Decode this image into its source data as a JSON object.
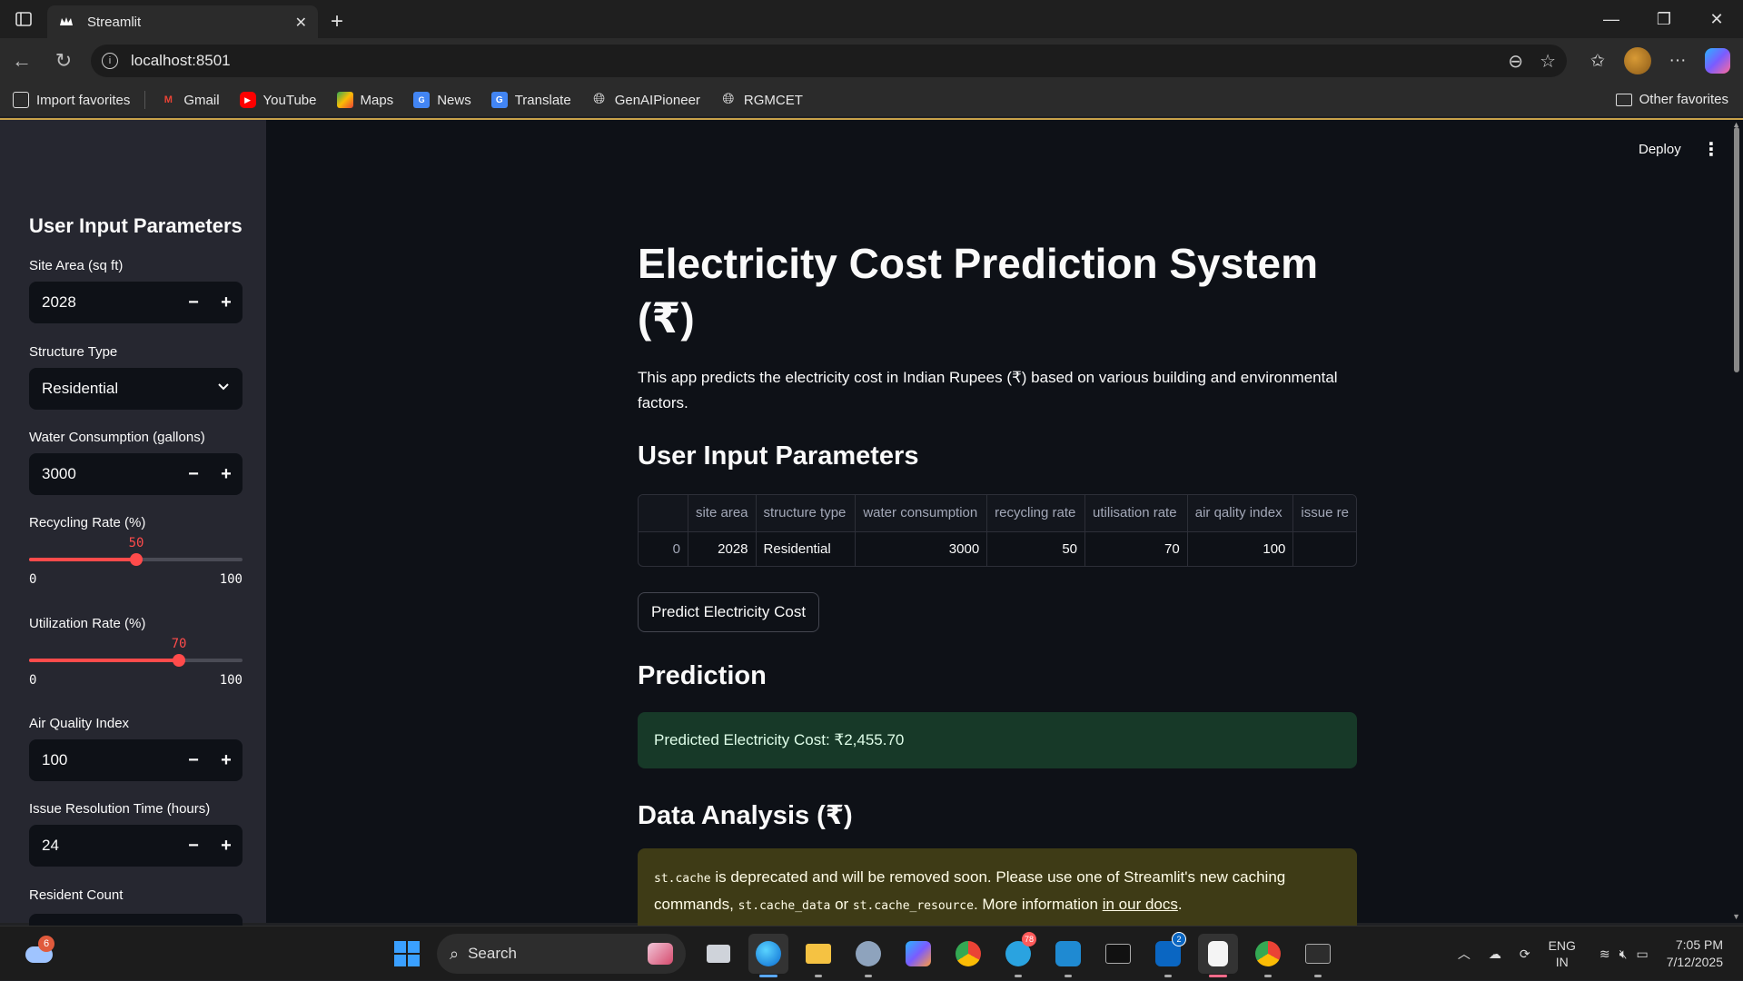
{
  "browser": {
    "tab_title": "Streamlit",
    "url": "localhost:8501",
    "favorites": [
      {
        "label": "Import favorites",
        "icon": "import-icon"
      },
      {
        "label": "Gmail",
        "icon": "gmail-icon",
        "color": "#ea4335"
      },
      {
        "label": "YouTube",
        "icon": "youtube-icon",
        "color": "#ff0000"
      },
      {
        "label": "Maps",
        "icon": "maps-icon",
        "color": "#34a853"
      },
      {
        "label": "News",
        "icon": "news-icon",
        "color": "#4285f4"
      },
      {
        "label": "Translate",
        "icon": "translate-icon",
        "color": "#4285f4"
      },
      {
        "label": "GenAIPioneer",
        "icon": "globe-icon"
      },
      {
        "label": "RGMCET",
        "icon": "globe-icon"
      }
    ],
    "other_favorites": "Other favorites"
  },
  "app": {
    "deploy": "Deploy",
    "accent": "#ff4b4b"
  },
  "sidebar": {
    "title": "User Input Parameters",
    "site_area": {
      "label": "Site Area (sq ft)",
      "value": "2028"
    },
    "structure_type": {
      "label": "Structure Type",
      "value": "Residential"
    },
    "water": {
      "label": "Water Consumption (gallons)",
      "value": "3000"
    },
    "recycling": {
      "label": "Recycling Rate (%)",
      "value": 50,
      "min": "0",
      "max": "100"
    },
    "utilization": {
      "label": "Utilization Rate (%)",
      "value": 70,
      "min": "0",
      "max": "100"
    },
    "aqi": {
      "label": "Air Quality Index",
      "value": "100"
    },
    "issue_time": {
      "label": "Issue Resolution Time (hours)",
      "value": "24"
    },
    "resident_count": {
      "label": "Resident Count"
    }
  },
  "main": {
    "title": "Electricity Cost Prediction System (₹)",
    "description": "This app predicts the electricity cost in Indian Rupees (₹) based on various building and environmental factors.",
    "params_heading": "User Input Parameters",
    "table": {
      "columns": [
        "",
        "site area",
        "structure type",
        "water consumption",
        "recycling rate",
        "utilisation rate",
        "air qality index",
        "issue re"
      ],
      "rows": [
        [
          "0",
          "2028",
          "Residential",
          "3000",
          "50",
          "70",
          "100",
          ""
        ]
      ]
    },
    "predict_button": "Predict Electricity Cost",
    "prediction_heading": "Prediction",
    "prediction_text": "Predicted Electricity Cost: ₹2,455.70",
    "analysis_heading": "Data Analysis (₹)",
    "warning": {
      "code1": "st.cache",
      "text1": " is deprecated and will be removed soon. Please use one of Streamlit's new caching commands, ",
      "code2": "st.cache_data",
      "text2": " or ",
      "code3": "st.cache_resource",
      "text3": ". More information ",
      "link": "in our docs",
      "text4": "."
    }
  },
  "taskbar": {
    "weather_badge": "6",
    "search": "Search",
    "telegram_badge": "78",
    "linkedin_badge": "2",
    "lang1": "ENG",
    "lang2": "IN",
    "time": "7:05 PM",
    "date": "7/12/2025"
  }
}
